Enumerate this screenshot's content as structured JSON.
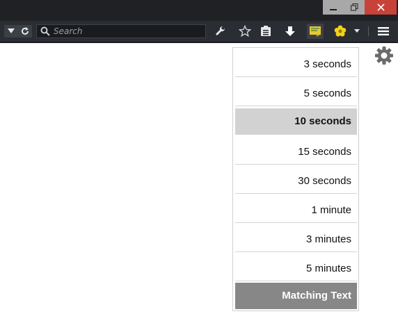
{
  "navbar": {
    "search_placeholder": "Search"
  },
  "menu": {
    "items": [
      "3 seconds",
      "5 seconds",
      "10 seconds",
      "15 seconds",
      "30 seconds",
      "1 minute",
      "3 minutes",
      "5 minutes"
    ],
    "selected": "10 seconds",
    "matching_text": "Matching Text"
  },
  "colors": {
    "toolbar_bg": "#2a2d33",
    "close_button": "#c9423a",
    "selected_item": "#d2d2d2",
    "matching_text_bg": "#878787"
  }
}
